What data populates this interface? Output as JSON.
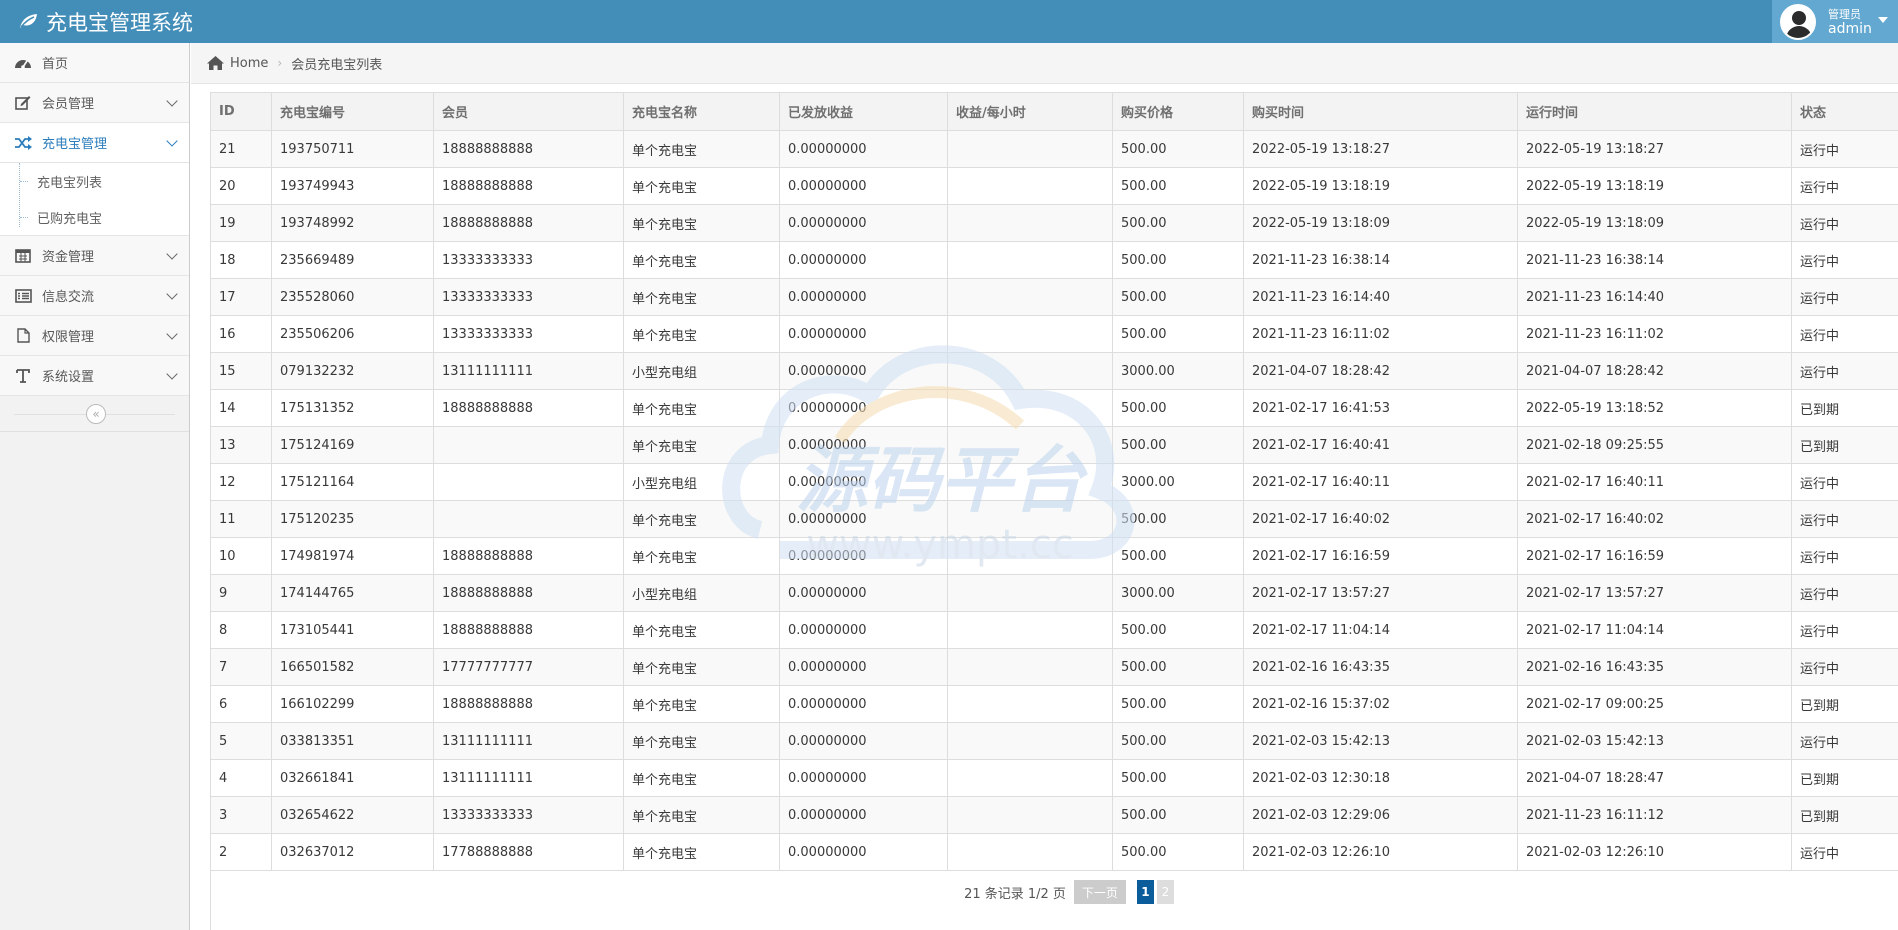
{
  "app": {
    "title": "充电宝管理系统",
    "accent": "#438eb9"
  },
  "user": {
    "role": "管理员",
    "name": "admin"
  },
  "sidebar": {
    "items": [
      {
        "label": "首页",
        "icon": "dashboard-icon"
      },
      {
        "label": "会员管理",
        "icon": "edit-icon"
      },
      {
        "label": "充电宝管理",
        "icon": "random-icon",
        "open": true,
        "children": [
          {
            "label": "充电宝列表"
          },
          {
            "label": "已购充电宝"
          }
        ]
      },
      {
        "label": "资金管理",
        "icon": "calendar-icon"
      },
      {
        "label": "信息交流",
        "icon": "list-icon"
      },
      {
        "label": "权限管理",
        "icon": "file-icon"
      },
      {
        "label": "系统设置",
        "icon": "text-icon"
      }
    ]
  },
  "breadcrumb": {
    "home": "Home",
    "current": "会员充电宝列表"
  },
  "table": {
    "columns": [
      "ID",
      "充电宝编号",
      "会员",
      "充电宝名称",
      "已发放收益",
      "收益/每小时",
      "购买价格",
      "购买时间",
      "运行时间",
      "状态"
    ],
    "rows": [
      [
        "21",
        "193750711",
        "18888888888",
        "单个充电宝",
        "0.00000000",
        "",
        "500.00",
        "2022-05-19 13:18:27",
        "2022-05-19 13:18:27",
        "运行中"
      ],
      [
        "20",
        "193749943",
        "18888888888",
        "单个充电宝",
        "0.00000000",
        "",
        "500.00",
        "2022-05-19 13:18:19",
        "2022-05-19 13:18:19",
        "运行中"
      ],
      [
        "19",
        "193748992",
        "18888888888",
        "单个充电宝",
        "0.00000000",
        "",
        "500.00",
        "2022-05-19 13:18:09",
        "2022-05-19 13:18:09",
        "运行中"
      ],
      [
        "18",
        "235669489",
        "13333333333",
        "单个充电宝",
        "0.00000000",
        "",
        "500.00",
        "2021-11-23 16:38:14",
        "2021-11-23 16:38:14",
        "运行中"
      ],
      [
        "17",
        "235528060",
        "13333333333",
        "单个充电宝",
        "0.00000000",
        "",
        "500.00",
        "2021-11-23 16:14:40",
        "2021-11-23 16:14:40",
        "运行中"
      ],
      [
        "16",
        "235506206",
        "13333333333",
        "单个充电宝",
        "0.00000000",
        "",
        "500.00",
        "2021-11-23 16:11:02",
        "2021-11-23 16:11:02",
        "运行中"
      ],
      [
        "15",
        "079132232",
        "13111111111",
        "小型充电组",
        "0.00000000",
        "",
        "3000.00",
        "2021-04-07 18:28:42",
        "2021-04-07 18:28:42",
        "运行中"
      ],
      [
        "14",
        "175131352",
        "18888888888",
        "单个充电宝",
        "0.00000000",
        "",
        "500.00",
        "2021-02-17 16:41:53",
        "2022-05-19 13:18:52",
        "已到期"
      ],
      [
        "13",
        "175124169",
        "",
        "单个充电宝",
        "0.00000000",
        "",
        "500.00",
        "2021-02-17 16:40:41",
        "2021-02-18 09:25:55",
        "已到期"
      ],
      [
        "12",
        "175121164",
        "",
        "小型充电组",
        "0.00000000",
        "",
        "3000.00",
        "2021-02-17 16:40:11",
        "2021-02-17 16:40:11",
        "运行中"
      ],
      [
        "11",
        "175120235",
        "",
        "单个充电宝",
        "0.00000000",
        "",
        "500.00",
        "2021-02-17 16:40:02",
        "2021-02-17 16:40:02",
        "运行中"
      ],
      [
        "10",
        "174981974",
        "18888888888",
        "单个充电宝",
        "0.00000000",
        "",
        "500.00",
        "2021-02-17 16:16:59",
        "2021-02-17 16:16:59",
        "运行中"
      ],
      [
        "9",
        "174144765",
        "18888888888",
        "小型充电组",
        "0.00000000",
        "",
        "3000.00",
        "2021-02-17 13:57:27",
        "2021-02-17 13:57:27",
        "运行中"
      ],
      [
        "8",
        "173105441",
        "18888888888",
        "单个充电宝",
        "0.00000000",
        "",
        "500.00",
        "2021-02-17 11:04:14",
        "2021-02-17 11:04:14",
        "运行中"
      ],
      [
        "7",
        "166501582",
        "17777777777",
        "单个充电宝",
        "0.00000000",
        "",
        "500.00",
        "2021-02-16 16:43:35",
        "2021-02-16 16:43:35",
        "运行中"
      ],
      [
        "6",
        "166102299",
        "18888888888",
        "单个充电宝",
        "0.00000000",
        "",
        "500.00",
        "2021-02-16 15:37:02",
        "2021-02-17 09:00:25",
        "已到期"
      ],
      [
        "5",
        "033813351",
        "13111111111",
        "单个充电宝",
        "0.00000000",
        "",
        "500.00",
        "2021-02-03 15:42:13",
        "2021-02-03 15:42:13",
        "运行中"
      ],
      [
        "4",
        "032661841",
        "13111111111",
        "单个充电宝",
        "0.00000000",
        "",
        "500.00",
        "2021-02-03 12:30:18",
        "2021-04-07 18:28:47",
        "已到期"
      ],
      [
        "3",
        "032654622",
        "13333333333",
        "单个充电宝",
        "0.00000000",
        "",
        "500.00",
        "2021-02-03 12:29:06",
        "2021-11-23 16:11:12",
        "已到期"
      ],
      [
        "2",
        "032637012",
        "17788888888",
        "单个充电宝",
        "0.00000000",
        "",
        "500.00",
        "2021-02-03 12:26:10",
        "2021-02-03 12:26:10",
        "运行中"
      ]
    ]
  },
  "pagination": {
    "info": "21 条记录 1/2 页",
    "next": "下一页",
    "pages": [
      "1",
      "2"
    ],
    "current": "1"
  },
  "watermark": {
    "text": "源码平台",
    "url": "www.ympt.cc"
  }
}
